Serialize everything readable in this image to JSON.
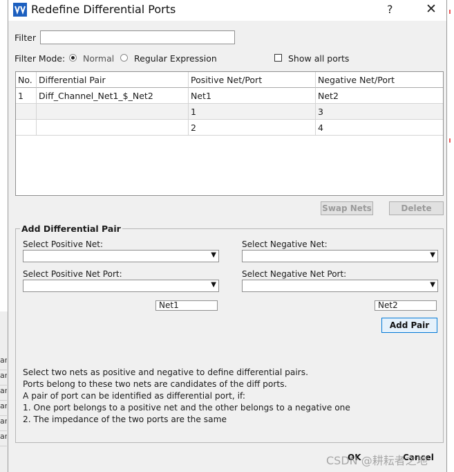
{
  "window": {
    "title": "Redefine Differential Ports",
    "help_label": "?",
    "close_label": "✕"
  },
  "filter": {
    "label": "Filter",
    "value": "",
    "mode_label": "Filter Mode:",
    "mode_options": [
      "Normal",
      "Regular Expression"
    ],
    "selected_mode": "Normal",
    "show_all_label": "Show all ports",
    "show_all_checked": false
  },
  "table": {
    "columns": [
      "No.",
      "Differential Pair",
      "Positive Net/Port",
      "Negative Net/Port"
    ],
    "rows": [
      [
        "1",
        "Diff_Channel_Net1_$_Net2",
        "Net1",
        "Net2"
      ],
      [
        "",
        "",
        "1",
        "3"
      ],
      [
        "",
        "",
        "2",
        "4"
      ]
    ]
  },
  "table_buttons": {
    "swap_label": "Swap Nets",
    "delete_label": "Delete"
  },
  "add_pair": {
    "group_title": "Add Differential Pair",
    "positive_net_label": "Select Positive Net:",
    "negative_net_label": "Select Negative Net:",
    "positive_port_label": "Select Positive Net Port:",
    "negative_port_label": "Select Negative Net Port:",
    "positive_net_value": "Net1",
    "negative_net_value": "Net2",
    "add_label": "Add Pair"
  },
  "description": [
    "Select two nets as positive and negative to define differential pairs.",
    "Ports belong to these two nets are candidates of the diff ports.",
    "A pair of port can be identified as differential port, if:",
    "1. One port belongs to a positive net and the other belongs to a negative one",
    "2. The impedance of the two ports are the same"
  ],
  "footer": {
    "ok_label": "OK",
    "cancel_label": "Cancel"
  },
  "watermark": "CSDN @耕耘者之地",
  "background_cells": [
    "ar",
    "ar",
    "ar",
    "ar",
    "ar",
    "ar"
  ],
  "colors": {
    "accent": "#0078d7",
    "dialog_bg": "#f0f0f0",
    "app_icon": "#1c5fbf"
  }
}
